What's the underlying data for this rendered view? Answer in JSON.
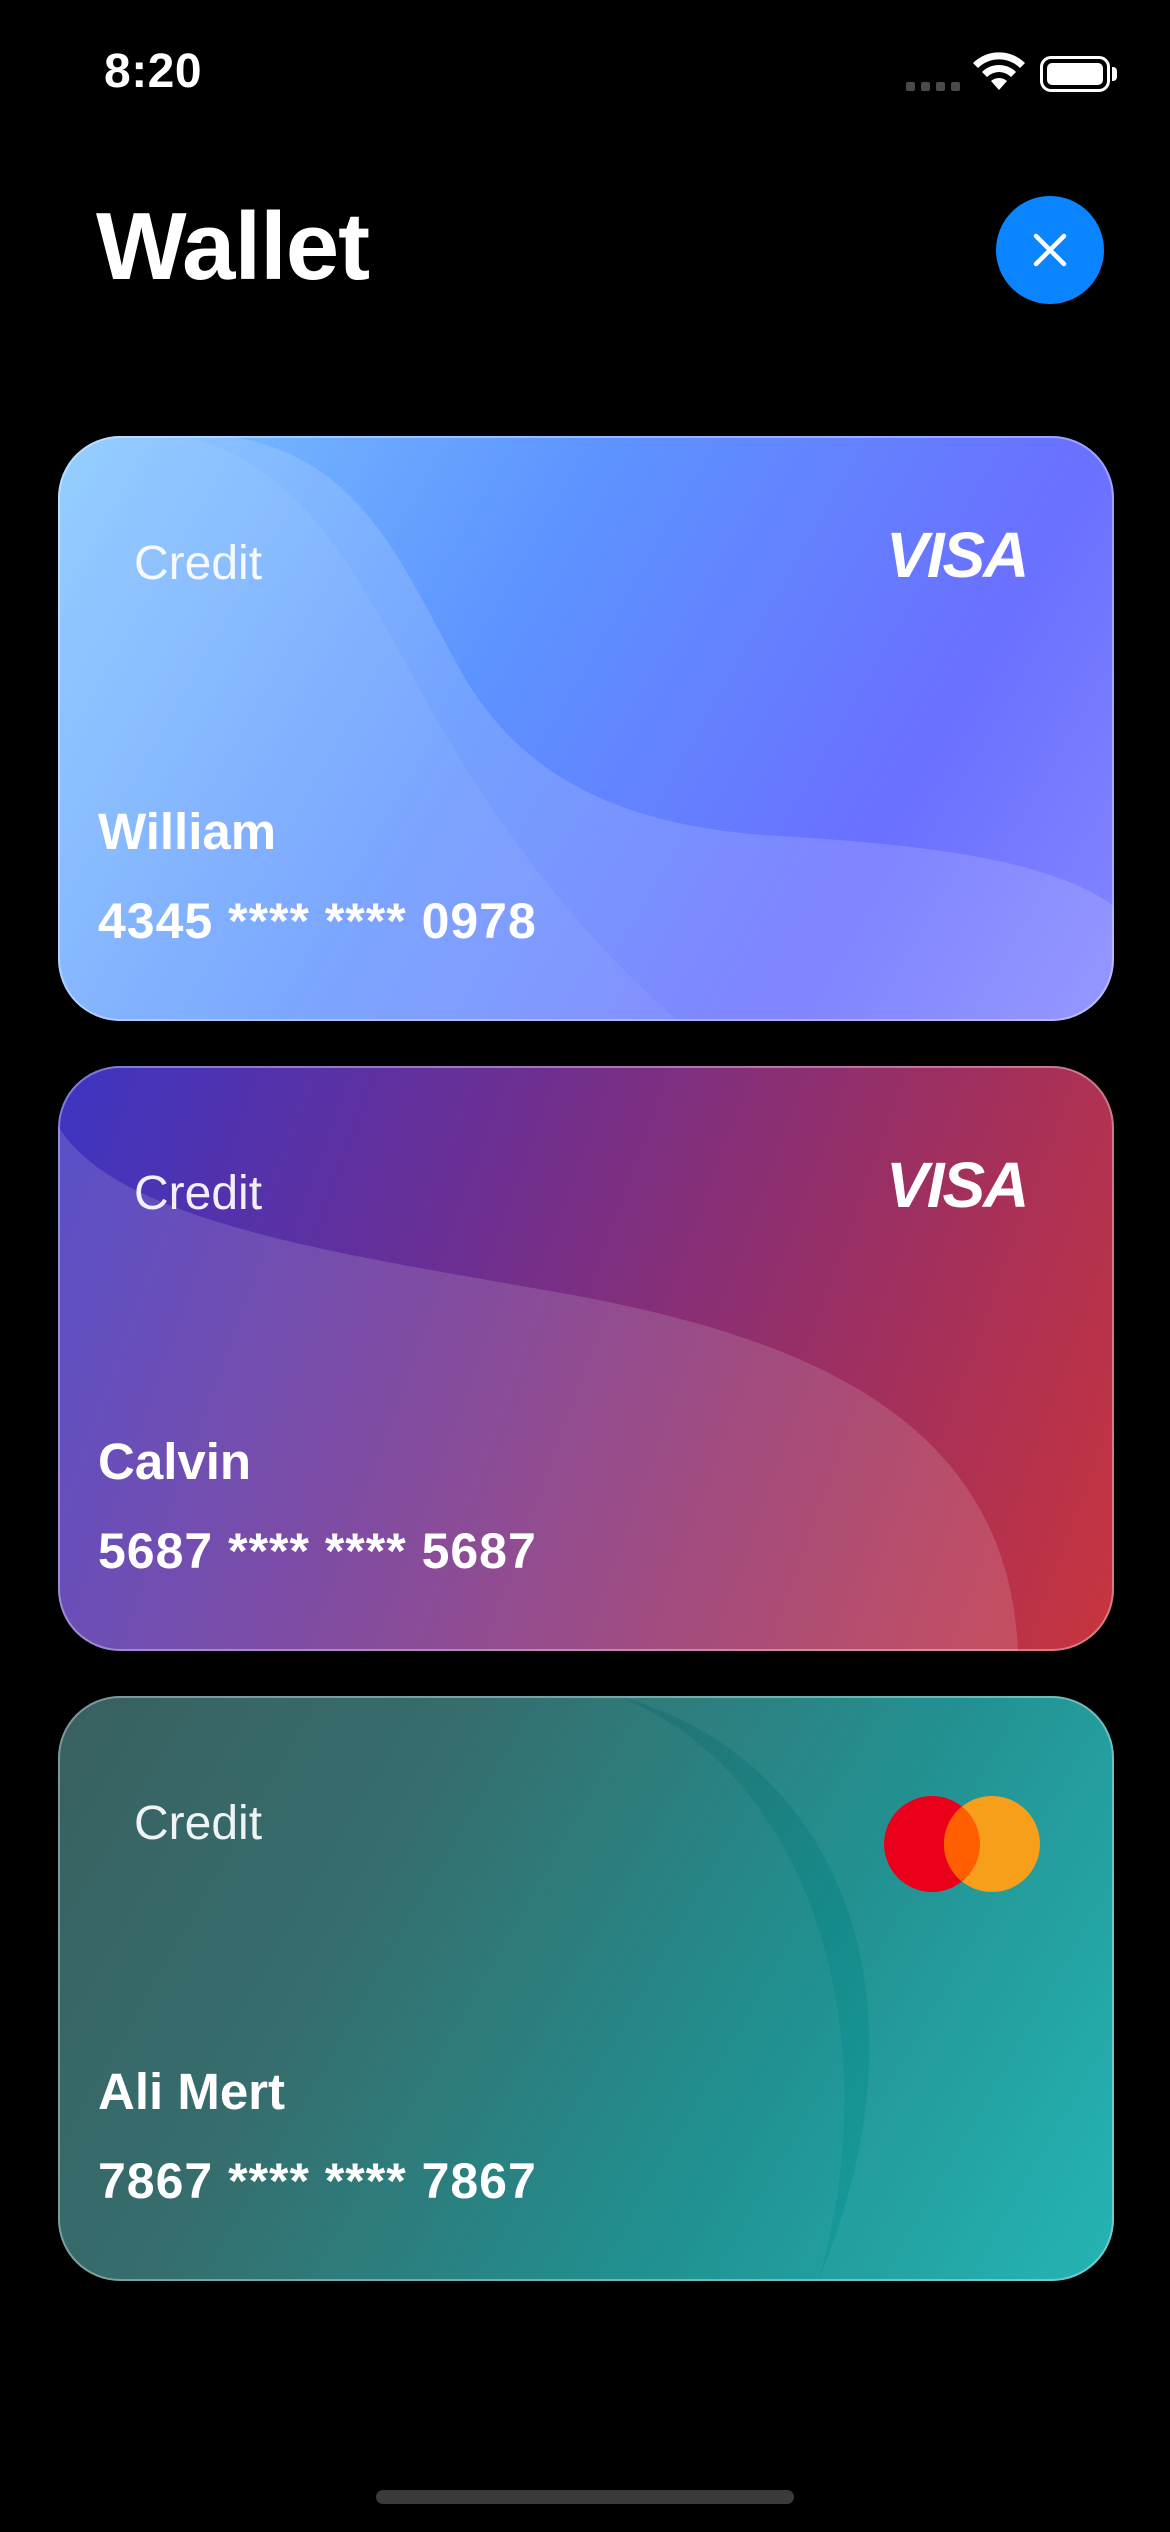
{
  "status_bar": {
    "time": "8:20"
  },
  "header": {
    "title": "Wallet"
  },
  "cards": [
    {
      "type": "Credit",
      "name": "William",
      "number": "4345 **** **** 0978",
      "network": "VISA",
      "gradient": [
        "#76bcff",
        "#5b8cff",
        "#6a6cff",
        "#8a88ff"
      ]
    },
    {
      "type": "Credit",
      "name": "Calvin",
      "number": "5687 **** **** 5687",
      "network": "VISA",
      "gradient": [
        "#3f36c0",
        "#7a2f86",
        "#b3304a",
        "#d2344a"
      ]
    },
    {
      "type": "Credit",
      "name": "Ali Mert",
      "number": "7867 **** **** 7867",
      "network": "mastercard",
      "gradient": [
        "#2e5a5a",
        "#2b6b6b",
        "#168f8f",
        "#19b1b1"
      ]
    }
  ],
  "icons": {
    "close": "close-icon",
    "wifi": "wifi-icon",
    "battery": "battery-icon",
    "signal": "signal-icon"
  },
  "colors": {
    "accent": "#0a84ff",
    "background": "#000000"
  }
}
